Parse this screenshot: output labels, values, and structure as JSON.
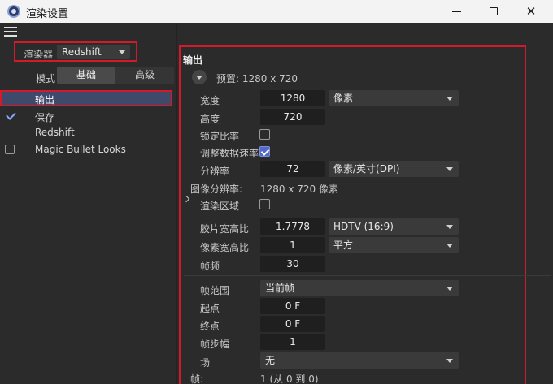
{
  "window": {
    "title": "渲染设置",
    "min_icon": "minimize-icon",
    "max_icon": "maximize-icon",
    "close_glyph": "✕"
  },
  "left": {
    "renderer_label": "渲染器",
    "renderer_value": "Redshift",
    "mode_label": "模式",
    "tabs": [
      "基础",
      "高级"
    ],
    "nav": [
      {
        "label": "输出",
        "state": "selected"
      },
      {
        "label": "保存",
        "state": "checked"
      },
      {
        "label": "Redshift",
        "state": "none"
      },
      {
        "label": "Magic Bullet Looks",
        "state": "unchecked"
      }
    ]
  },
  "output": {
    "title": "输出",
    "preset": "预置: 1280 x 720",
    "width_label": "宽度",
    "width_value": "1280",
    "unit_value": "像素",
    "height_label": "高度",
    "height_value": "720",
    "lock_ratio_label": "锁定比率",
    "lock_ratio_checked": false,
    "adjust_rate_label": "调整数据速率",
    "adjust_rate_checked": true,
    "resolution_label": "分辨率",
    "resolution_value": "72",
    "resolution_unit": "像素/英寸(DPI)",
    "image_res_label": "图像分辨率:",
    "image_res_value": "1280 x 720 像素",
    "render_region_label": "渲染区域",
    "render_region_checked": false,
    "film_aspect_label": "胶片宽高比",
    "film_aspect_value": "1.7778",
    "film_aspect_preset": "HDTV (16:9)",
    "pixel_aspect_label": "像素宽高比",
    "pixel_aspect_value": "1",
    "pixel_aspect_preset": "平方",
    "fps_label": "帧频",
    "fps_value": "30",
    "frame_range_label": "帧范围",
    "frame_range_value": "当前帧",
    "start_label": "起点",
    "start_value": "0 F",
    "end_label": "终点",
    "end_value": "0 F",
    "step_label": "帧步幅",
    "step_value": "1",
    "field_label": "场",
    "field_value": "无",
    "frames_label": "帧:",
    "frames_value": "1 (从 0 到 0)"
  }
}
